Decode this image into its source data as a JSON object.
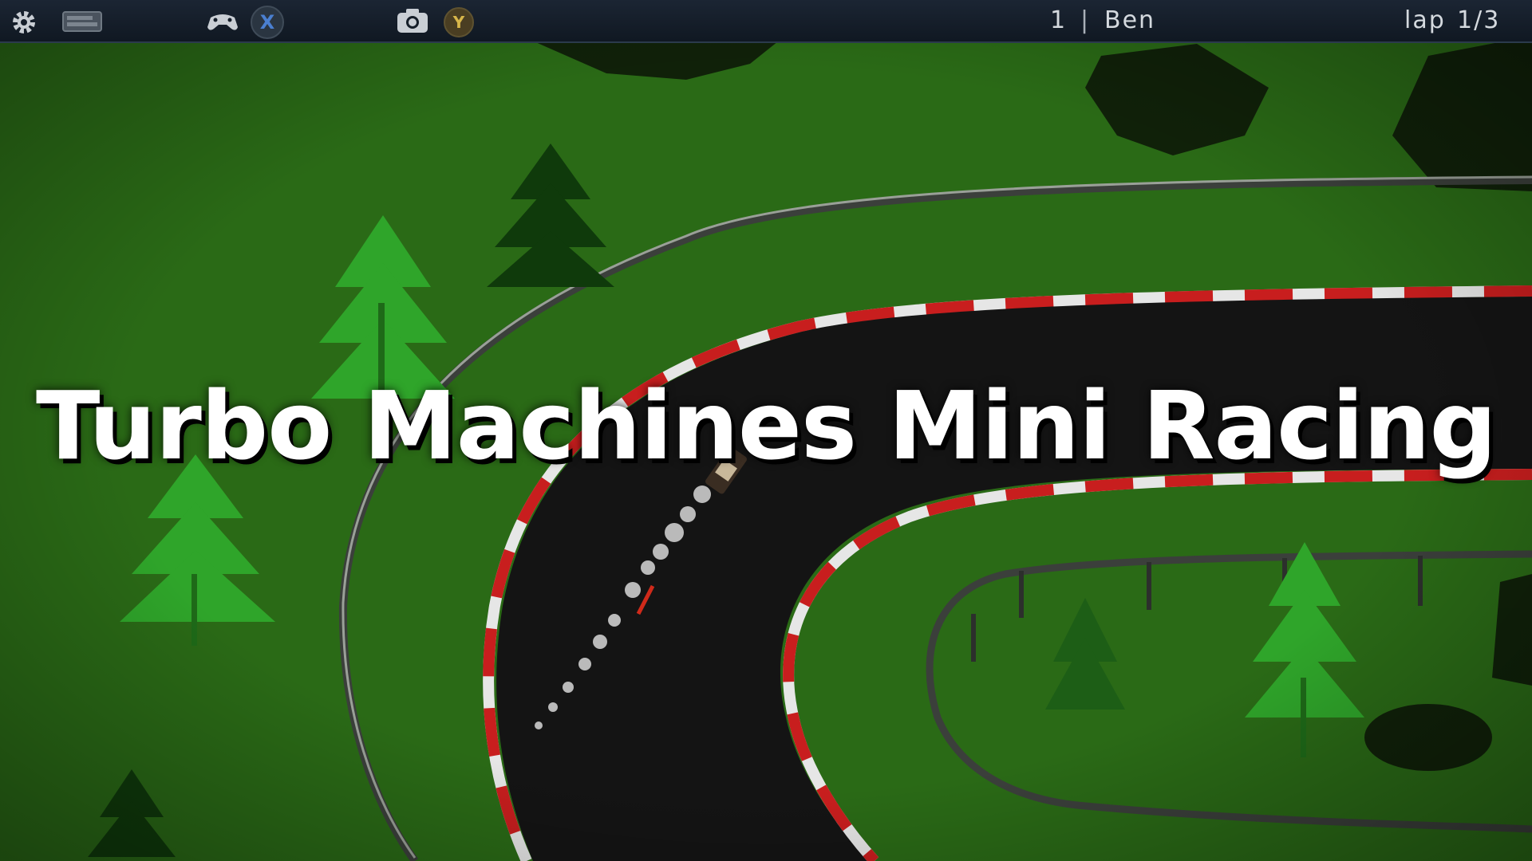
{
  "hud": {
    "icons": [
      "gear-icon",
      "keyboard-icon",
      "gamepad-icon",
      "x-button-icon",
      "camera-icon",
      "y-button-icon"
    ],
    "x_button": "X",
    "y_button": "Y",
    "position": "1",
    "player_name": "Ben",
    "lap_label": "lap",
    "lap_value": "1/3"
  },
  "title": "Turbo Machines Mini Racing",
  "colors": {
    "grass": "#2a6a16",
    "asphalt": "#141414",
    "curb_red": "#c81e1e",
    "curb_white": "#e6e6e6",
    "trees": "#2fa52a",
    "hud_bg": "#141d28"
  }
}
